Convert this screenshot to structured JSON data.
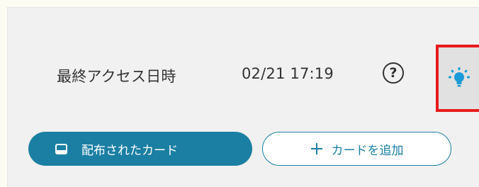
{
  "access": {
    "label": "最終アクセス日時",
    "value": "02/21 17:19"
  },
  "help": {
    "glyph": "?"
  },
  "tip": {
    "icon": "lightbulb-icon",
    "color": "#1b9bd7"
  },
  "buttons": {
    "distributed_cards": "配布されたカード",
    "add_card": "カードを追加"
  },
  "colors": {
    "accent": "#1b7fa3",
    "highlight_border": "#e81c1c"
  }
}
